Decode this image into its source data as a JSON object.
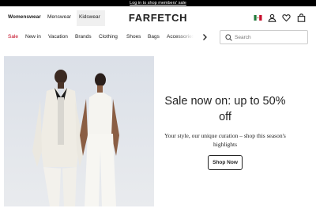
{
  "promo_bar": {
    "link_text": "Log in to shop members' sale"
  },
  "departments": [
    {
      "label": "Womenswear",
      "active": true
    },
    {
      "label": "Menswear",
      "active": false
    },
    {
      "label": "Kidswear",
      "active": false
    }
  ],
  "logo": "FARFETCH",
  "utility_icons": [
    "flag-icon",
    "account-icon",
    "wishlist-icon",
    "bag-icon"
  ],
  "categories": [
    "Sale",
    "New in",
    "Vacation",
    "Brands",
    "Clothing",
    "Shoes",
    "Bags",
    "Accessories"
  ],
  "search": {
    "placeholder": "Search",
    "icon": "search-icon"
  },
  "hero": {
    "headline": "Sale now on: up to 50% off",
    "subtext": "Your style, our unique curation – shop this season's highlights",
    "cta": "Shop Now"
  },
  "colors": {
    "sale": "#c0001a",
    "promo_bg": "#000000",
    "text": "#222222"
  }
}
